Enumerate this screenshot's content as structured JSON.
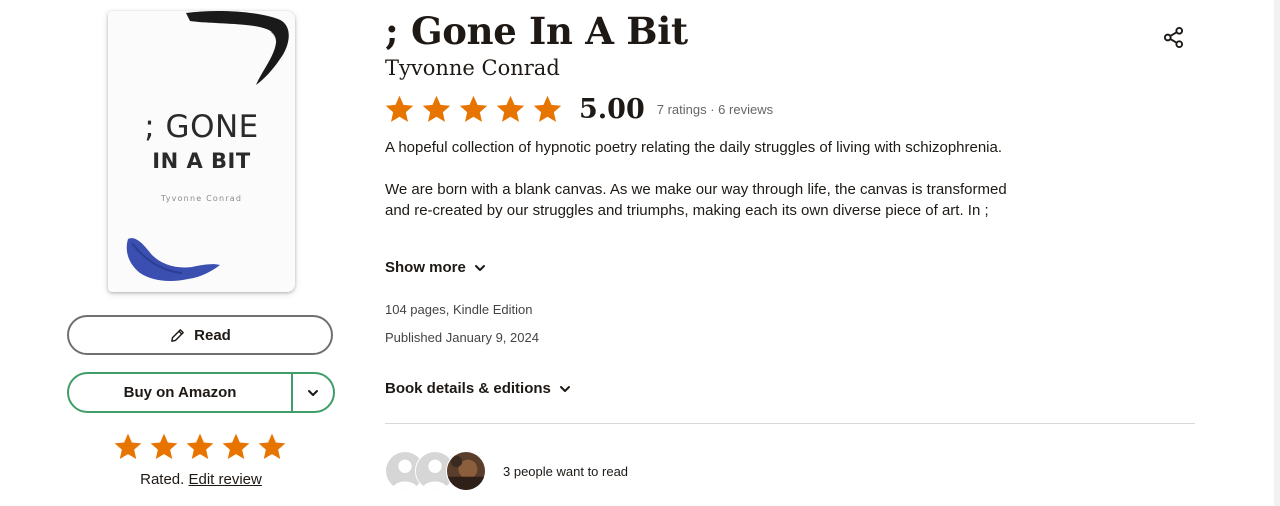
{
  "book": {
    "title": "; Gone In A Bit",
    "author": "Tyvonne Conrad",
    "cover": {
      "line1": "; GONE",
      "line2": "IN A BIT",
      "author": "Tyvonne Conrad"
    },
    "rating": {
      "stars": 5,
      "average": "5.00",
      "counts": "7 ratings · 6 reviews"
    },
    "description": {
      "paragraph1": "A hopeful collection of hypnotic poetry relating the daily struggles of living with schizophrenia.",
      "paragraph2": "We are born with a blank canvas. As we make our way through life, the canvas is transformed and re-created by our struggles and triumphs, making each its own diverse piece of art. In ;"
    },
    "show_more": "Show more",
    "pages_format": "104 pages, Kindle Edition",
    "published": "Published January 9, 2024",
    "details_link": "Book details & editions"
  },
  "actions": {
    "read_label": "Read",
    "buy_label": "Buy on Amazon"
  },
  "user_rating": {
    "stars": 5,
    "rated_label": "Rated.",
    "edit_label": "Edit review"
  },
  "social": {
    "want_to_read": "3 people want to read"
  },
  "colors": {
    "star": "#e87400",
    "amazon_border": "#409d69",
    "cover_brush_dark": "#1a1a1a",
    "cover_brush_blue": "#3a4fb0"
  },
  "icons": [
    "pencil-icon",
    "chevron-down-icon",
    "share-icon",
    "star-icon",
    "user-placeholder-icon"
  ]
}
